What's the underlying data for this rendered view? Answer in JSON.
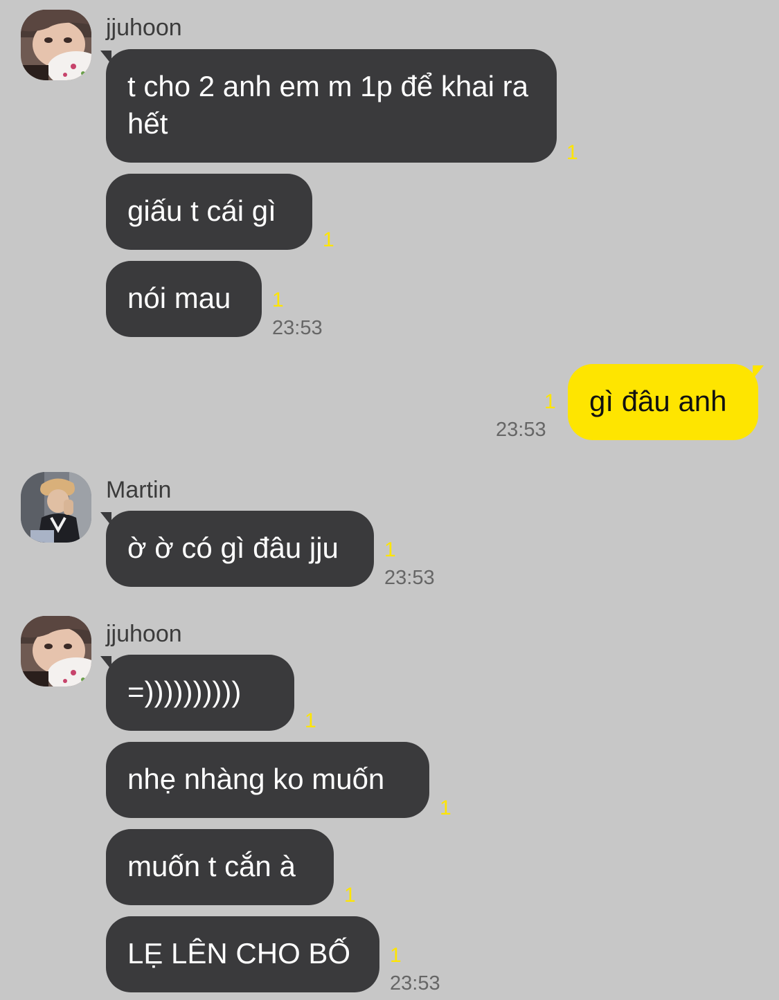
{
  "colors": {
    "background": "#c7c7c7",
    "received_bubble": "#3a3a3c",
    "sent_bubble": "#fee500",
    "read_count": "#fee500",
    "timestamp": "#666666"
  },
  "groups": [
    {
      "sender": "jjuhoon",
      "avatar_icon": "avatar-jjuhoon-icon",
      "messages": [
        {
          "text": "t cho 2 anh em m 1p để khai ra hết",
          "read_count": "1"
        },
        {
          "text": "giấu t cái gì",
          "read_count": "1"
        },
        {
          "text": "nói mau",
          "read_count": "1",
          "time": "23:53"
        }
      ]
    },
    {
      "sender": "me",
      "messages": [
        {
          "text": "gì đâu anh",
          "read_count": "1",
          "time": "23:53"
        }
      ]
    },
    {
      "sender": "Martin",
      "avatar_icon": "avatar-martin-icon",
      "messages": [
        {
          "text": "ờ ờ có gì đâu jju",
          "read_count": "1",
          "time": "23:53"
        }
      ]
    },
    {
      "sender": "jjuhoon",
      "avatar_icon": "avatar-jjuhoon-icon",
      "messages": [
        {
          "text": "=))))))))))",
          "read_count": "1"
        },
        {
          "text": "nhẹ nhàng ko muốn",
          "read_count": "1"
        },
        {
          "text": "muốn t cắn à",
          "read_count": "1"
        },
        {
          "text": "LẸ LÊN CHO BỐ",
          "read_count": "1",
          "time": "23:53"
        }
      ]
    }
  ]
}
